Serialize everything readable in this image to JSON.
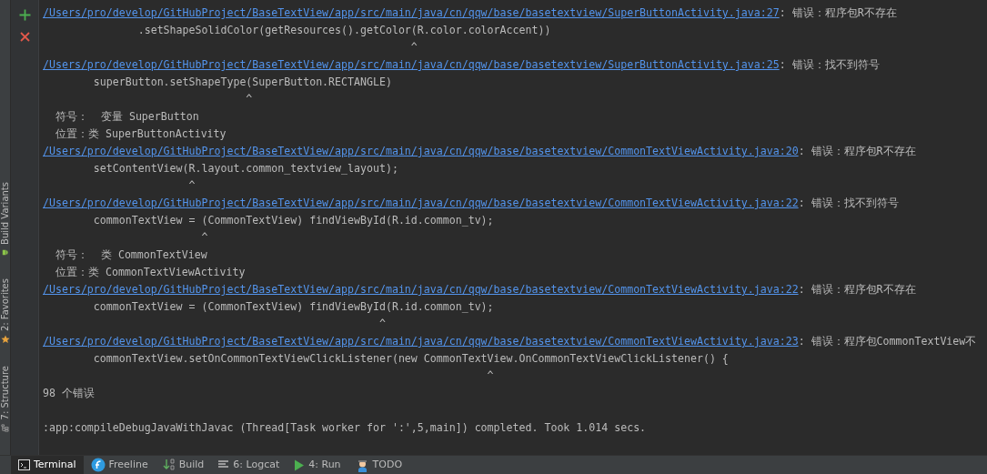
{
  "side_tabs": [
    {
      "label": "Build Variants"
    },
    {
      "label": "2: Favorites"
    },
    {
      "label": "7: Structure"
    }
  ],
  "gutter_buttons": [
    {
      "kind": "add"
    },
    {
      "kind": "close"
    }
  ],
  "console": {
    "lines": [
      {
        "kind": "link",
        "path": "/Users/pro/develop/GitHubProject/BaseTextView/app/src/main/java/cn/qqw/base/basetextview/SuperButtonActivity.java:27",
        "message": ": 错误：程序包R不存在"
      },
      {
        "kind": "text",
        "text": "               .setShapeSolidColor(getResources().getColor(R.color.colorAccent))"
      },
      {
        "kind": "text",
        "text": "                                                          ^"
      },
      {
        "kind": "link",
        "path": "/Users/pro/develop/GitHubProject/BaseTextView/app/src/main/java/cn/qqw/base/basetextview/SuperButtonActivity.java:25",
        "message": ": 错误：找不到符号"
      },
      {
        "kind": "text",
        "text": "        superButton.setShapeType(SuperButton.RECTANGLE)"
      },
      {
        "kind": "text",
        "text": "                                ^"
      },
      {
        "kind": "text",
        "text": "  符号：  变量 SuperButton"
      },
      {
        "kind": "text",
        "text": "  位置：类 SuperButtonActivity"
      },
      {
        "kind": "link",
        "path": "/Users/pro/develop/GitHubProject/BaseTextView/app/src/main/java/cn/qqw/base/basetextview/CommonTextViewActivity.java:20",
        "message": ": 错误：程序包R不存在"
      },
      {
        "kind": "text",
        "text": "        setContentView(R.layout.common_textview_layout);"
      },
      {
        "kind": "text",
        "text": "                       ^"
      },
      {
        "kind": "link",
        "path": "/Users/pro/develop/GitHubProject/BaseTextView/app/src/main/java/cn/qqw/base/basetextview/CommonTextViewActivity.java:22",
        "message": ": 错误：找不到符号"
      },
      {
        "kind": "text",
        "text": "        commonTextView = (CommonTextView) findViewById(R.id.common_tv);"
      },
      {
        "kind": "text",
        "text": "                         ^"
      },
      {
        "kind": "text",
        "text": "  符号：  类 CommonTextView"
      },
      {
        "kind": "text",
        "text": "  位置：类 CommonTextViewActivity"
      },
      {
        "kind": "link",
        "path": "/Users/pro/develop/GitHubProject/BaseTextView/app/src/main/java/cn/qqw/base/basetextview/CommonTextViewActivity.java:22",
        "message": ": 错误：程序包R不存在"
      },
      {
        "kind": "text",
        "text": "        commonTextView = (CommonTextView) findViewById(R.id.common_tv);"
      },
      {
        "kind": "text",
        "text": "                                                     ^"
      },
      {
        "kind": "link",
        "path": "/Users/pro/develop/GitHubProject/BaseTextView/app/src/main/java/cn/qqw/base/basetextview/CommonTextViewActivity.java:23",
        "message": ": 错误：程序包CommonTextView不"
      },
      {
        "kind": "text",
        "text": "        commonTextView.setOnCommonTextViewClickListener(new CommonTextView.OnCommonTextViewClickListener() {"
      },
      {
        "kind": "text",
        "text": "                                                                      ^"
      },
      {
        "kind": "text",
        "text": "98 个错误"
      },
      {
        "kind": "blank"
      },
      {
        "kind": "text",
        "text": ":app:compileDebugJavaWithJavac (Thread[Task worker for ':',5,main]) completed. Took 1.014 secs."
      }
    ]
  },
  "bottom_tabs": [
    {
      "label": "Terminal",
      "selected": true
    },
    {
      "label": "Freeline",
      "selected": false
    },
    {
      "label": "Build",
      "selected": false
    },
    {
      "label": "6: Logcat",
      "selected": false
    },
    {
      "label": "4: Run",
      "selected": false
    },
    {
      "label": "TODO",
      "selected": false
    }
  ]
}
